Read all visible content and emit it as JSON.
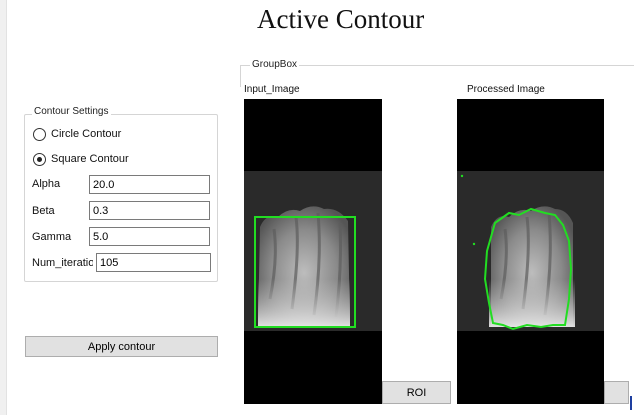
{
  "window": {
    "title": "Active Contour"
  },
  "contour_settings": {
    "group_title": "Contour Settings",
    "options": [
      {
        "label": "Circle Contour",
        "selected": false
      },
      {
        "label": "Square Contour",
        "selected": true
      }
    ],
    "fields": [
      {
        "label": "Alpha",
        "value": "20.0"
      },
      {
        "label": "Beta",
        "value": "0.3"
      },
      {
        "label": "Gamma",
        "value": "5.0"
      },
      {
        "label": "Num_iteratio",
        "value": "105"
      }
    ],
    "apply_label": "Apply contour"
  },
  "groupbox": {
    "title": "GroupBox",
    "input_caption": "Input_Image",
    "processed_caption": "Processed Image",
    "roi_label": "ROI"
  },
  "colors": {
    "contour": "#22dd22",
    "image_bg": "#2a2a2a",
    "frame": "#000000",
    "button_face": "#e1e1e1"
  }
}
